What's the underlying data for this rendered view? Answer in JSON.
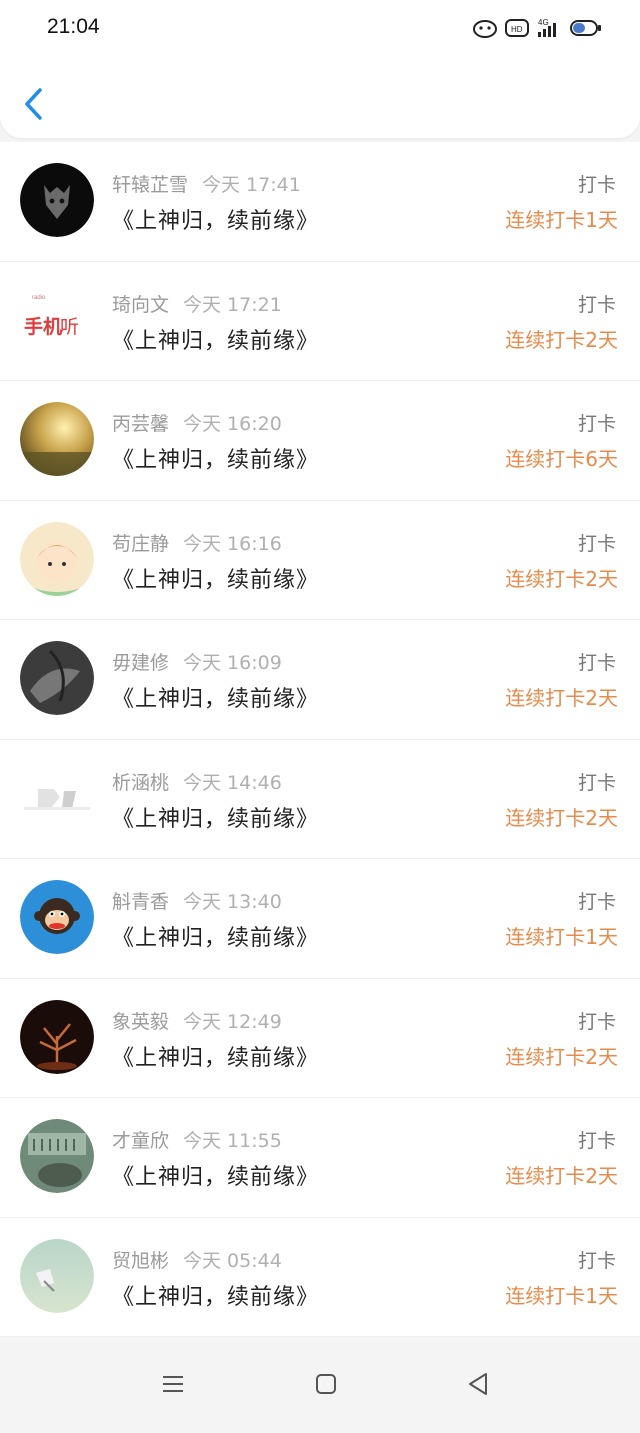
{
  "status_bar": {
    "time": "21:04"
  },
  "header": {
    "back_icon": "chevron-left-icon",
    "accent": "#1e90e8"
  },
  "colors": {
    "streak": "#e88a4a",
    "meta": "#9b9b9b"
  },
  "entries": [
    {
      "name": "轩辕芷雪",
      "time": "今天 17:41",
      "title": "《上神归，续前缘》",
      "badge": "打卡",
      "streak": "连续打卡1天"
    },
    {
      "name": "琦向文",
      "time": "今天 17:21",
      "title": "《上神归，续前缘》",
      "badge": "打卡",
      "streak": "连续打卡2天"
    },
    {
      "name": "丙芸馨",
      "time": "今天 16:20",
      "title": "《上神归，续前缘》",
      "badge": "打卡",
      "streak": "连续打卡6天"
    },
    {
      "name": "苟庄静",
      "time": "今天 16:16",
      "title": "《上神归，续前缘》",
      "badge": "打卡",
      "streak": "连续打卡2天"
    },
    {
      "name": "毋建修",
      "time": "今天 16:09",
      "title": "《上神归，续前缘》",
      "badge": "打卡",
      "streak": "连续打卡2天"
    },
    {
      "name": "析涵桃",
      "time": "今天 14:46",
      "title": "《上神归，续前缘》",
      "badge": "打卡",
      "streak": "连续打卡2天"
    },
    {
      "name": "斛青香",
      "time": "今天 13:40",
      "title": "《上神归，续前缘》",
      "badge": "打卡",
      "streak": "连续打卡1天"
    },
    {
      "name": "象英毅",
      "time": "今天 12:49",
      "title": "《上神归，续前缘》",
      "badge": "打卡",
      "streak": "连续打卡2天"
    },
    {
      "name": "才童欣",
      "time": "今天 11:55",
      "title": "《上神归，续前缘》",
      "badge": "打卡",
      "streak": "连续打卡2天"
    },
    {
      "name": "贸旭彬",
      "time": "今天 05:44",
      "title": "《上神归，续前缘》",
      "badge": "打卡",
      "streak": "连续打卡1天"
    }
  ],
  "nav": {
    "menu_icon": "menu-icon",
    "home_icon": "home-square-icon",
    "back_icon": "back-triangle-icon"
  }
}
